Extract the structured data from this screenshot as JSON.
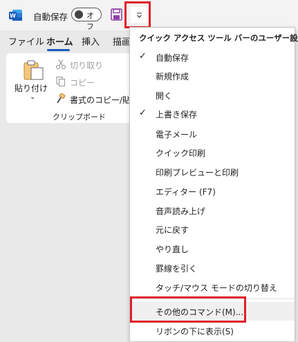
{
  "titlebar": {
    "autosave_label": "自動保存",
    "autosave_state": "オフ",
    "app_icon": "word-logo-icon",
    "save_icon": "save-icon",
    "dropdown_icon": "chevron-down-icon"
  },
  "tabs": [
    "ファイル",
    "ホーム",
    "挿入",
    "描画"
  ],
  "active_tab": "ホーム",
  "ribbon": {
    "paste_label": "貼り付け",
    "cut_label": "切り取り",
    "copy_label": "コピー",
    "format_painter_label": "書式のコピー/貼り付",
    "group_label": "クリップボード"
  },
  "menu": {
    "header": "クイック アクセス ツール バーのユーザー設定",
    "items": [
      {
        "label": "自動保存",
        "checked": true
      },
      {
        "label": "新規作成",
        "checked": false
      },
      {
        "label": "開く",
        "checked": false
      },
      {
        "label": "上書き保存",
        "checked": true
      },
      {
        "label": "電子メール",
        "checked": false
      },
      {
        "label": "クイック印刷",
        "checked": false
      },
      {
        "label": "印刷プレビューと印刷",
        "checked": false
      },
      {
        "label": "エディター (F7)",
        "checked": false
      },
      {
        "label": "音声読み上げ",
        "checked": false
      },
      {
        "label": "元に戻す",
        "checked": false
      },
      {
        "label": "やり直し",
        "checked": false
      },
      {
        "label": "罫線を引く",
        "checked": false
      },
      {
        "label": "タッチ/マウス モードの切り替え",
        "checked": false
      },
      {
        "label": "その他のコマンド(M)...",
        "checked": false
      },
      {
        "label": "リボンの下に表示(S)",
        "checked": false
      }
    ],
    "check_glyph": "✓"
  },
  "colors": {
    "highlight": "#e0202a",
    "accent": "#185abd",
    "word_blue": "#185abd"
  }
}
